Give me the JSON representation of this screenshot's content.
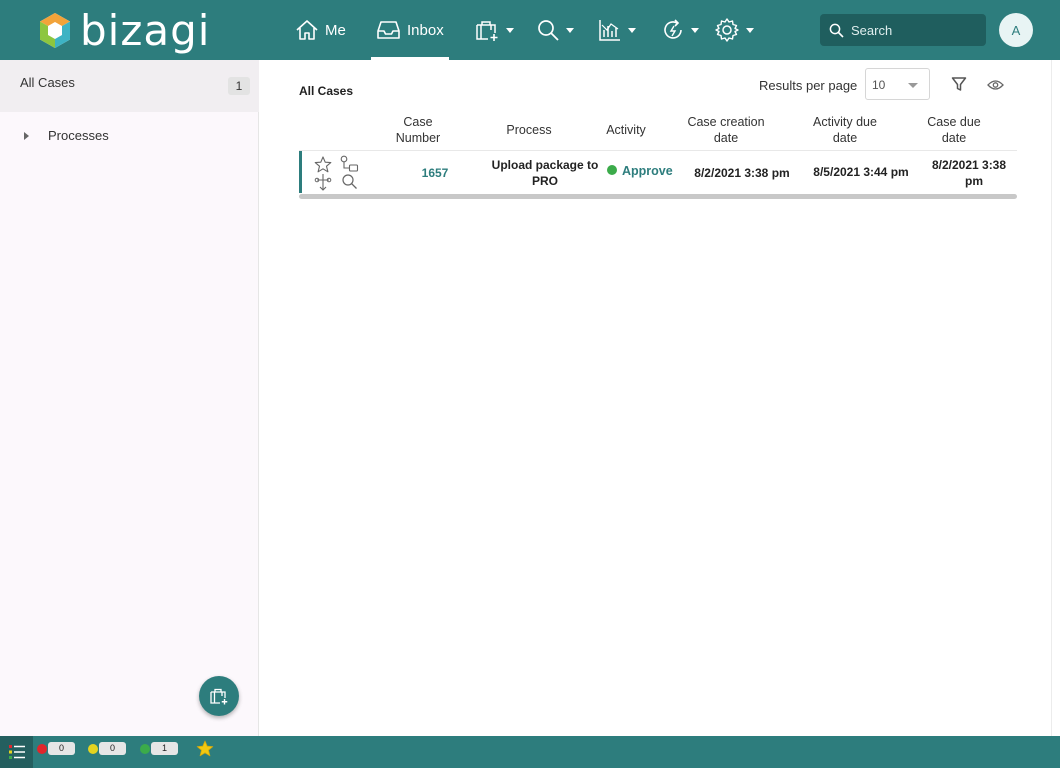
{
  "brand": {
    "name": "bizagi"
  },
  "nav": {
    "me": "Me",
    "inbox": "Inbox",
    "search_placeholder": "Search",
    "avatar_initial": "A"
  },
  "sidebar": {
    "all_cases_label": "All Cases",
    "all_cases_count": "1",
    "processes_label": "Processes"
  },
  "main": {
    "title": "All Cases",
    "results_per_page_label": "Results per page",
    "results_per_page_value": "10",
    "columns": {
      "case_number": [
        "Case",
        "Number"
      ],
      "process": "Process",
      "activity": "Activity",
      "case_creation_date": [
        "Case creation",
        "date"
      ],
      "activity_due_date": [
        "Activity due",
        "date"
      ],
      "case_due_date": [
        "Case due",
        "date"
      ]
    },
    "rows": [
      {
        "case_number": "1657",
        "process": [
          "Upload package to",
          "PRO"
        ],
        "activity": "Approve",
        "activity_status_color": "#3bab4a",
        "case_creation_date": "8/2/2021 3:38 pm",
        "activity_due_date": "8/5/2021 3:44 pm",
        "case_due_date": [
          "8/2/2021 3:38",
          "pm"
        ]
      }
    ]
  },
  "footer": {
    "counters": [
      {
        "color": "#e0262c",
        "value": "0"
      },
      {
        "color": "#e4d420",
        "value": "0"
      },
      {
        "color": "#3bab4a",
        "value": "1"
      }
    ]
  },
  "colors": {
    "primary": "#2d7d7d",
    "primary_dark": "#1f5e5e"
  }
}
